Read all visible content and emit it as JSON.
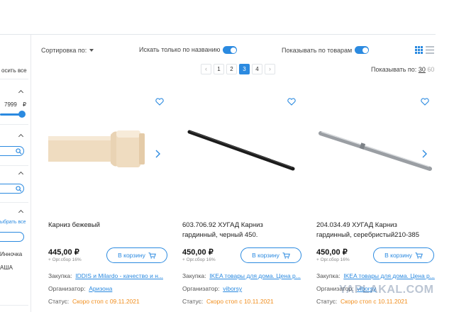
{
  "sidebar": {
    "select_all_partial": "осить все",
    "price_max": "7999",
    "currency": "₽",
    "choose_all_partial": "ыбрать все",
    "item1_partial": "Инночка",
    "item2_partial": "АША"
  },
  "toolbar": {
    "sort_label": "Сортировка по:",
    "search_by_name_label": "Искать только по названию",
    "show_by_items_label": "Показывать по товарам"
  },
  "pagination": {
    "pages": [
      "1",
      "2",
      "3",
      "4"
    ],
    "active_page": "3",
    "per_page_label": "Показывать по:",
    "per_page_selected": "30",
    "per_page_other": "60"
  },
  "products": [
    {
      "title_line1": "Карниз бежевый",
      "title_line2": "",
      "price": "445,00 ₽",
      "fee": "+ Орг.сбор 16%",
      "cart_label": "В корзину",
      "purchase_label": "Закупка:",
      "purchase_value": "IDDIS и Milardo - качество и н...",
      "organizer_label": "Организатор:",
      "organizer_value": "Аризона",
      "status_label": "Статус:",
      "status_value": "Скоро стоп с 09.11.2021"
    },
    {
      "title_line1": "603.706.92 ХУГАД Карниз",
      "title_line2": "гардинный, черный 450.",
      "price": "450,00 ₽",
      "fee": "+ Орг.сбор 16%",
      "cart_label": "В корзину",
      "purchase_label": "Закупка:",
      "purchase_value": "IKEA товары для дома. Цена р...",
      "organizer_label": "Организатор:",
      "organizer_value": "viborsy",
      "status_label": "Статус:",
      "status_value": "Скоро стоп с 10.11.2021"
    },
    {
      "title_line1": "204.034.49 ХУГАД Карниз",
      "title_line2": "гардинный, серебристый210-385",
      "price": "450,00 ₽",
      "fee": "+ Орг.сбор 16%",
      "cart_label": "В корзину",
      "purchase_label": "Закупка:",
      "purchase_value": "IKEA товары для дома. Цена р...",
      "organizer_label": "Организатор:",
      "organizer_value": "viborsy",
      "status_label": "Статус:",
      "status_value": "Скоро стоп с 10.11.2021"
    }
  ],
  "watermark": "YAPLAKAL.COM",
  "colors": {
    "accent": "#2b8ae0",
    "status_warning": "#f08c1a"
  }
}
